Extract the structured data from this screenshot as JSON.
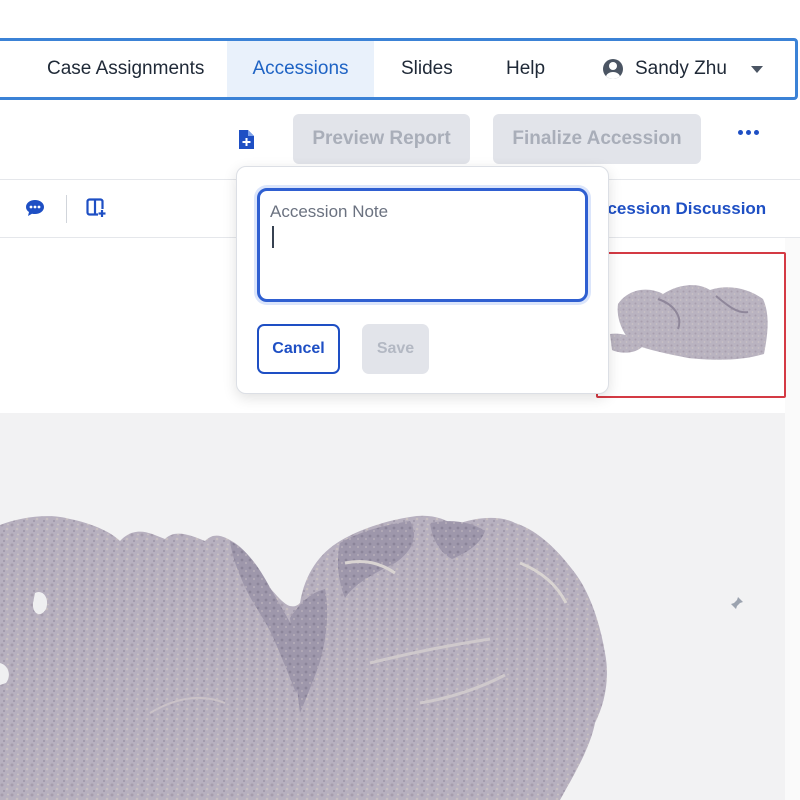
{
  "nav": {
    "items": [
      {
        "label": "Case Assignments"
      },
      {
        "label": "Accessions",
        "active": true
      },
      {
        "label": "Slides"
      },
      {
        "label": "Help"
      }
    ],
    "user_name": "Sandy Zhu"
  },
  "toolbar": {
    "preview_report_label": "Preview Report",
    "finalize_accession_label": "Finalize Accession"
  },
  "subbar": {
    "discussion_label": "ccession Discussion"
  },
  "note_popover": {
    "label": "Accession Note",
    "value": "",
    "cancel_label": "Cancel",
    "save_label": "Save"
  },
  "icons": {
    "add_note": "file-plus-icon",
    "chat": "chat-bubble-icon",
    "layout": "split-panel-add-icon",
    "more": "ellipsis-icon",
    "user": "user-circle-icon",
    "pin": "pushpin-icon"
  },
  "colors": {
    "accent": "#1e4fc4",
    "nav_border": "#3b82d6",
    "thumbnail_selected_border": "#d43a44",
    "disabled_button_bg": "#e2e4ea"
  }
}
